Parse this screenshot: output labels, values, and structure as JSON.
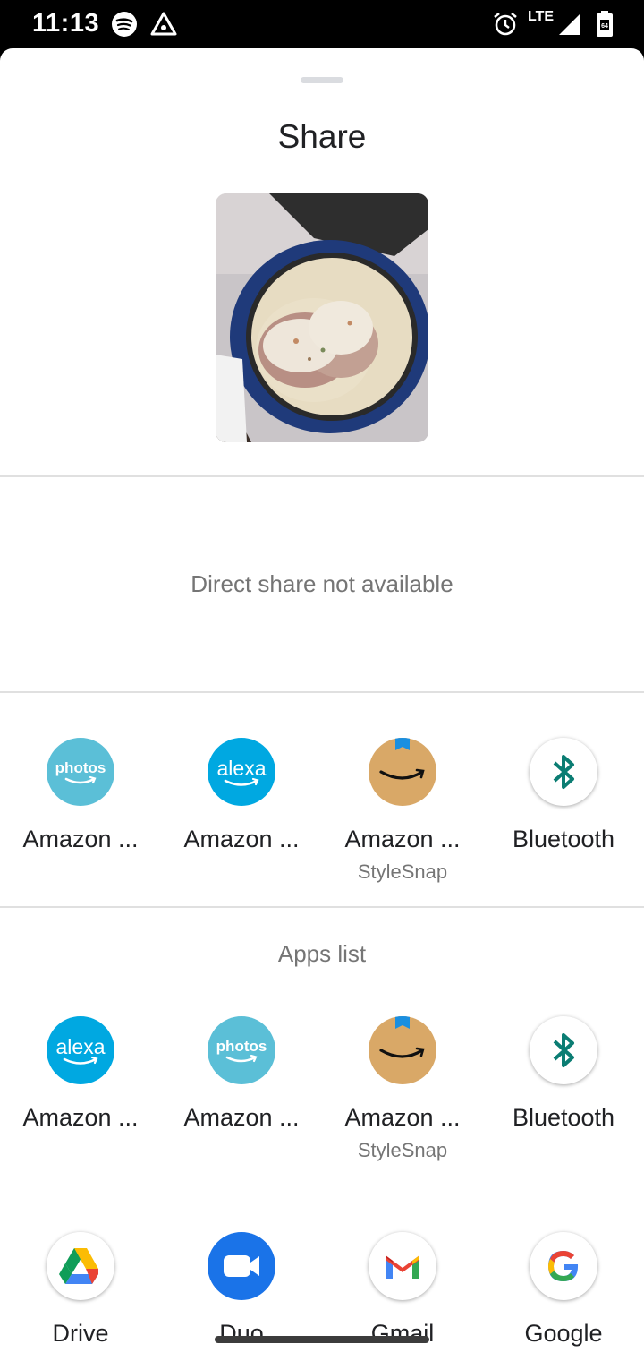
{
  "status_bar": {
    "time": "11:13",
    "network": "LTE"
  },
  "sheet": {
    "title": "Share",
    "direct_share_message": "Direct share not available",
    "apps_list_header": "Apps list"
  },
  "top_row": [
    {
      "label": "Amazon ...",
      "icon": "amazon-photos-icon"
    },
    {
      "label": "Amazon ...",
      "icon": "alexa-icon"
    },
    {
      "label": "Amazon ...",
      "sublabel": "StyleSnap",
      "icon": "amazon-shopping-icon"
    },
    {
      "label": "Bluetooth",
      "icon": "bluetooth-icon"
    }
  ],
  "apps_list": [
    {
      "label": "Amazon ...",
      "icon": "alexa-icon"
    },
    {
      "label": "Amazon ...",
      "icon": "amazon-photos-icon"
    },
    {
      "label": "Amazon ...",
      "sublabel": "StyleSnap",
      "icon": "amazon-shopping-icon"
    },
    {
      "label": "Bluetooth",
      "icon": "bluetooth-icon"
    },
    {
      "label": "Drive",
      "icon": "google-drive-icon"
    },
    {
      "label": "Duo",
      "icon": "google-duo-icon"
    },
    {
      "label": "Gmail",
      "icon": "gmail-icon"
    },
    {
      "label": "Google",
      "icon": "google-icon"
    }
  ],
  "icon_text": {
    "photos": "photos",
    "alexa": "alexa"
  },
  "colors": {
    "photos_bg": "#5bbfd7",
    "alexa_bg": "#00a8e1",
    "amazon_bg": "#d9a867",
    "bluetooth": "#0b7d73",
    "duo_bg": "#1a73e8"
  }
}
